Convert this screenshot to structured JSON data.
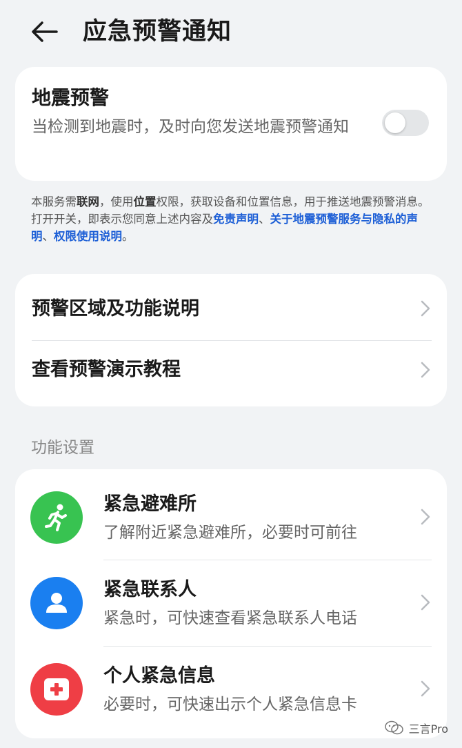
{
  "header": {
    "title": "应急预警通知"
  },
  "quake": {
    "title": "地震预警",
    "desc": "当检测到地震时，及时向您发送地震预警通知",
    "enabled": false
  },
  "notice": {
    "p1": "本服务需",
    "b1": "联网",
    "p2": "，使用",
    "b2": "位置",
    "p3": "权限，获取设备和位置信息，用于推送地震预警消息。打开开关，即表示您同意上述内容及",
    "l1": "免责声明",
    "p4": "、",
    "l2": "关于地震预警服务与隐私的声明",
    "p5": "、",
    "l3": "权限使用说明",
    "p6": "。"
  },
  "info": {
    "row1": "预警区域及功能说明",
    "row2": "查看预警演示教程"
  },
  "section": {
    "label": "功能设置"
  },
  "func": [
    {
      "title": "紧急避难所",
      "sub": "了解附近紧急避难所，必要时可前往",
      "color": "#38c351",
      "icon": "running-person-icon"
    },
    {
      "title": "紧急联系人",
      "sub": "紧急时，可快速查看紧急联系人电话",
      "color": "#1a7ff0",
      "icon": "contact-person-icon"
    },
    {
      "title": "个人紧急信息",
      "sub": "必要时，可快速出示个人紧急信息卡",
      "color": "#ef3e45",
      "icon": "medical-card-icon"
    }
  ],
  "watermark": {
    "text": "三言Pro"
  }
}
